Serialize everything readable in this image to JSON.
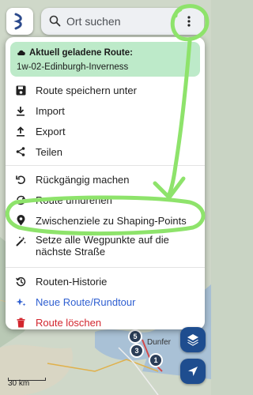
{
  "search": {
    "placeholder": "Ort suchen"
  },
  "route_info": {
    "title": "Aktuell geladene Route:",
    "name": "1w-02-Edinburgh-Inverness"
  },
  "menu": {
    "save": "Route speichern unter",
    "import": "Import",
    "export": "Export",
    "share": "Teilen",
    "undo": "Rückgängig machen",
    "reverse": "Route umdrehen",
    "shaping": "Zwischenziele zu Shaping-Points",
    "snap": "Setze alle Wegpunkte auf die nächste Straße",
    "history": "Routen-Historie",
    "new_route": "Neue Route/Rundtour",
    "delete": "Route löschen"
  },
  "map": {
    "place_label": "Dunfer",
    "scale": "30 km",
    "pins": [
      "5",
      "3",
      "1"
    ]
  },
  "colors": {
    "route_info_bg": "#bdeac9",
    "annotation": "#8ee36b",
    "accent_blue": "#2f5fd1",
    "danger_red": "#d3262e",
    "fab": "#1e4d8f"
  }
}
